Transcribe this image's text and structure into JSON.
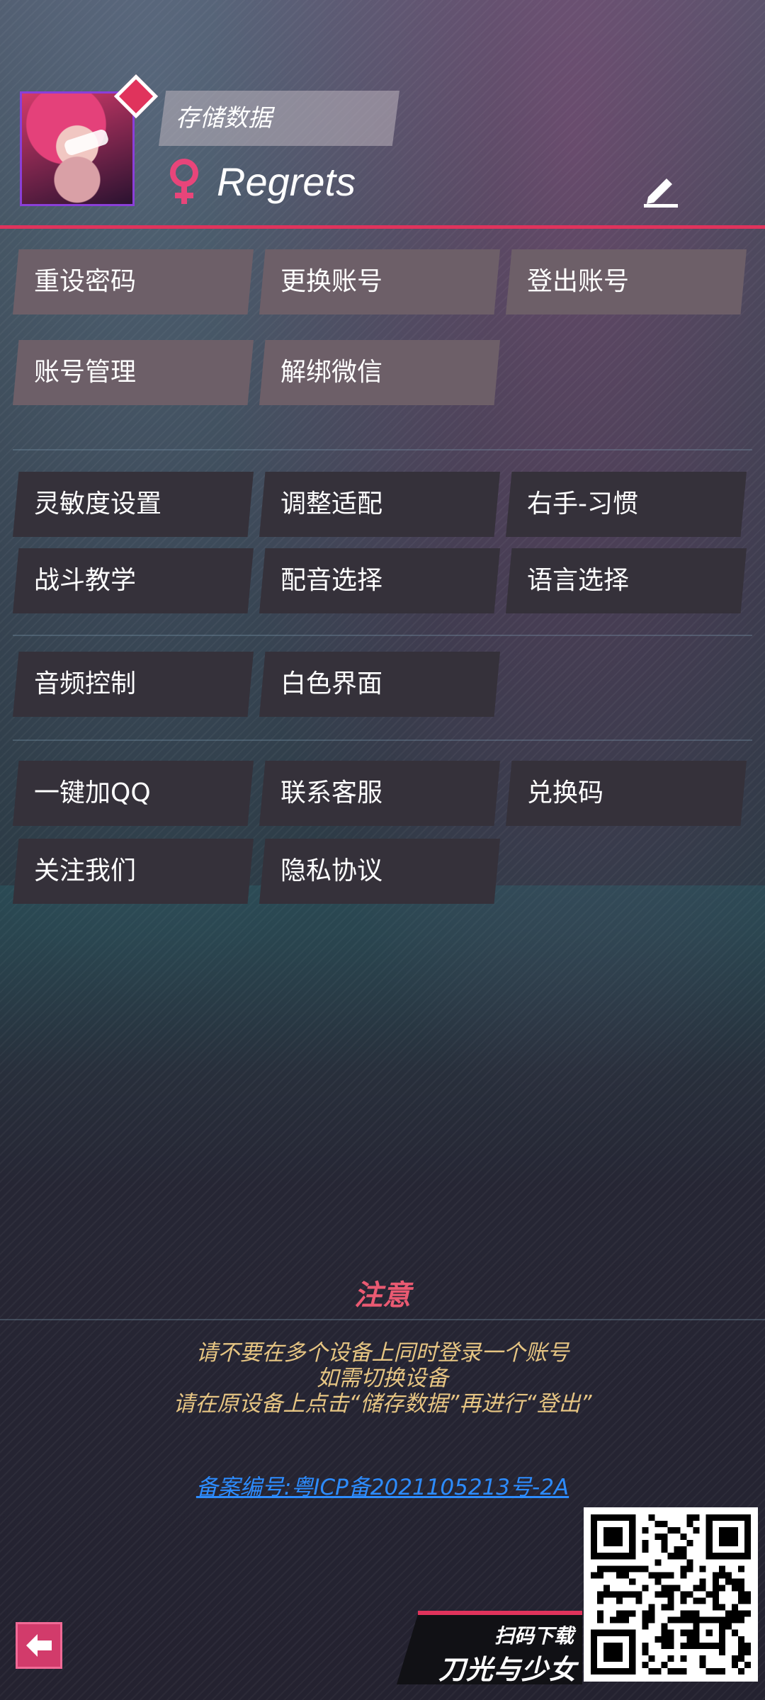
{
  "header": {
    "save_label": "存储数据",
    "username": "Regrets",
    "gender": "female"
  },
  "account_buttons": [
    {
      "label": "重设密码"
    },
    {
      "label": "更换账号"
    },
    {
      "label": "登出账号"
    },
    {
      "label": "账号管理"
    },
    {
      "label": "解绑微信"
    }
  ],
  "settings_buttons": [
    {
      "label": "灵敏度设置"
    },
    {
      "label": "调整适配"
    },
    {
      "label": "右手-习惯"
    },
    {
      "label": "战斗教学"
    },
    {
      "label": "配音选择"
    },
    {
      "label": "语言选择"
    }
  ],
  "display_buttons": [
    {
      "label": "音频控制"
    },
    {
      "label": "白色界面"
    }
  ],
  "social_buttons": [
    {
      "label": "一键加QQ"
    },
    {
      "label": "联系客服"
    },
    {
      "label": "兑换码"
    },
    {
      "label": "关注我们"
    },
    {
      "label": "隐私协议"
    }
  ],
  "notice": {
    "title": "注意",
    "lines": [
      "请不要在多个设备上同时登录一个账号",
      "如需切换设备",
      "请在原设备上点击“储存数据”再进行“登出”"
    ]
  },
  "icp": "备案编号:粤ICP备2021105213号-2A",
  "download": {
    "scan_label": "扫码下载",
    "game_name": "刀光与少女"
  },
  "colors": {
    "accent": "#e0335c",
    "button_light": "#6d5f68",
    "button_dark": "#35313a",
    "notice_title": "#ea5a72",
    "notice_text": "#e6c583",
    "link": "#2d8cff"
  }
}
